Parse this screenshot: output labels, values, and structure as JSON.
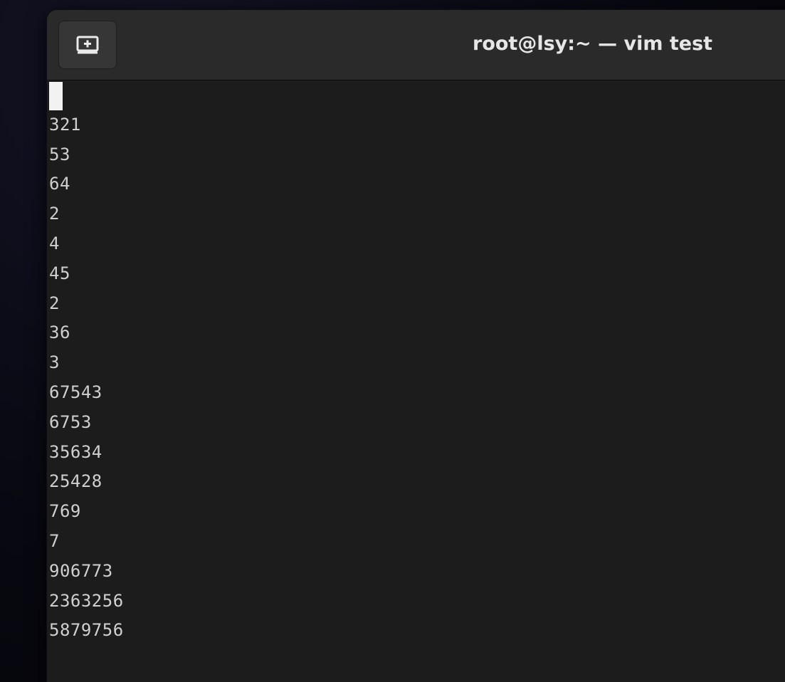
{
  "window": {
    "title": "root@lsy:~ — vim test"
  },
  "titlebar": {
    "new_tab_icon": "new-tab-icon"
  },
  "editor": {
    "lines": [
      "",
      "321",
      "53",
      "64",
      "2",
      "4",
      "45",
      "2",
      "36",
      "3",
      "67543",
      "6753",
      "35634",
      "25428",
      "769",
      "7",
      "906773",
      "2363256",
      "5879756"
    ]
  },
  "colors": {
    "terminal_bg": "#1c1c1c",
    "titlebar_bg": "#2a2a2a",
    "text": "#d0d0d0",
    "cursor": "#f2f2f2"
  }
}
